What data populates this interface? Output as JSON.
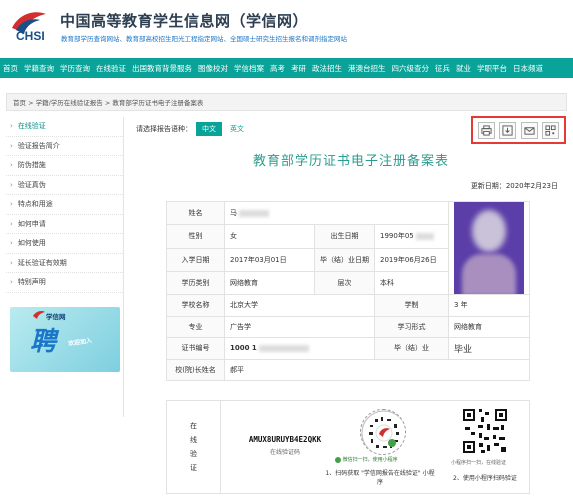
{
  "header": {
    "logo_text": "CHSI",
    "site_title": "中国高等教育学生信息网（学信网）",
    "site_subtitle": "教育部学历查询网站、教育部高校招生阳光工程指定网站、全国硕士研究生招生报名和调剂指定网站"
  },
  "nav": [
    "首页",
    "学籍查询",
    "学历查询",
    "在线验证",
    "出国教育背景服务",
    "图像校对",
    "学信档案",
    "高考",
    "考研",
    "政法招生",
    "港澳台招生",
    "四六级查分",
    "征兵",
    "就业",
    "学职平台",
    "日本频道"
  ],
  "breadcrumb": "首页 > 学籍/学历在线验证报告 > 教育部学历证书电子注册备案表",
  "sidebar": {
    "items": [
      "在线验证",
      "验证报告简介",
      "防伪措施",
      "验证真伪",
      "特点和用途",
      "如何申请",
      "如何使用",
      "延长验证有效期",
      "特别声明"
    ],
    "banner_word": "学信网",
    "banner_big": "聘",
    "banner_small": "欢迎加入"
  },
  "lang": {
    "prompt": "请选择报告语种：",
    "options": [
      "中文",
      "英文"
    ],
    "selected": "中文"
  },
  "tools": [
    "print-icon",
    "download-icon",
    "mail-icon",
    "qr-share-icon"
  ],
  "document": {
    "title": "教育部学历证书电子注册备案表",
    "update_label": "更新日期：",
    "update_date": "2020年2月23日"
  },
  "info": {
    "name_label": "姓名",
    "name_value": "马",
    "gender_label": "性别",
    "gender_value": "女",
    "birth_label": "出生日期",
    "birth_value": "1990年05",
    "enroll_label": "入学日期",
    "enroll_value": "2017年03月01日",
    "grad_label": "毕（结）业日期",
    "grad_value": "2019年06月26日",
    "type_label": "学历类别",
    "type_value": "网络教育",
    "level_label": "层次",
    "level_value": "本科",
    "school_label": "学校名称",
    "school_value": "北京大学",
    "system_label": "学制",
    "system_value": "3 年",
    "major_label": "专业",
    "major_value": "广告学",
    "form_label": "学习形式",
    "form_value": "网络教育",
    "cert_label": "证书编号",
    "cert_value": "1000 1",
    "result_label": "毕（结）业",
    "result_value": "毕业",
    "president_label": "校(院)长姓名",
    "president_value": "郝平"
  },
  "verify": {
    "label_chars": [
      "在",
      "线",
      "验",
      "证"
    ],
    "code": "AMUX8URUYB4E2QKK",
    "code_caption": "在线验证码",
    "mini_caption": "微信扫一扫，使用小程序",
    "step1": "1、扫码获取 \"学信网报告在线验证\" 小程序",
    "qr_caption": "小程序扫一扫，在线验证",
    "step2": "2、使用小程序扫码验证"
  }
}
